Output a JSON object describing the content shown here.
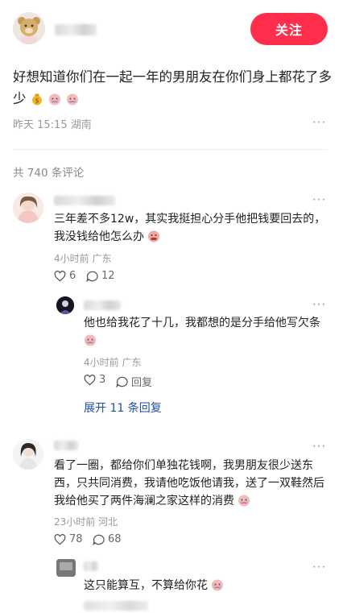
{
  "header": {
    "follow_label": "关注"
  },
  "post": {
    "text": "好想知道你们在一起一年的男朋友在你们身上都花了多少",
    "meta": "昨天 15:15 湖南",
    "more": "···"
  },
  "comments_header": {
    "count_label": "共 740 条评论"
  },
  "comments": [
    {
      "text": "三年差不多12w，其实我挺担心分手他把钱要回去的，我没钱给他怎么办",
      "meta": "4小时前 广东",
      "likes": "6",
      "replies": "12",
      "more": "···",
      "reply": {
        "text": "他也给我花了十几，我都想的是分手给他写欠条",
        "meta": "4小时前 广东",
        "likes": "3",
        "reply_label": "回复",
        "more": "···"
      },
      "expand_label": "展开 11 条回复"
    },
    {
      "text": "看了一圈，都给你们单独花钱啊，我男朋友很少送东西，只共同消费，我请他吃饭他请我，送了一双鞋然后我给他买了两件海澜之家这样的消费",
      "meta": "23小时前 河北",
      "likes": "78",
      "replies": "68",
      "more": "···",
      "reply": {
        "text": "这只能算互，不算给你花",
        "more": "···"
      }
    }
  ],
  "colors": {
    "accent": "#ff2e4d",
    "link": "#1f4fa8",
    "meta": "#999999"
  }
}
